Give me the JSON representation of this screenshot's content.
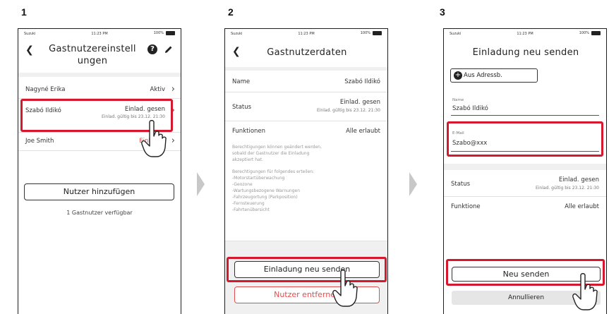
{
  "steps": [
    "1",
    "2",
    "3"
  ],
  "statusbar": {
    "carrier": "Suzuki",
    "time": "11:23 PM",
    "battery": "100%"
  },
  "panel1": {
    "title_line1": "Gastnutzereinstell",
    "title_line2": "ungen",
    "users": [
      {
        "name": "Nagyné Erika",
        "status": "Aktiv"
      },
      {
        "name": "Szabó Ildikó",
        "status": "Einlad. gesen",
        "sub": "Einlad. gültig bis 23.12. 21:30"
      },
      {
        "name": "Joe Smith",
        "status": "Einlad. a"
      }
    ],
    "add_button": "Nutzer hinzufügen",
    "available": "1 Gastnutzer verfügbar"
  },
  "panel2": {
    "title": "Gastnutzerdaten",
    "name_label": "Name",
    "name_value": "Szabó Ildikó",
    "status_label": "Status",
    "status_value": "Einlad. gesen",
    "status_sub": "Einlad. gültig bis 23.12. 21:30",
    "func_label": "Funktionen",
    "func_value": "Alle erlaubt",
    "info1": [
      "Berechtigungen können geändert werden,",
      "sobald der Gastnutzer die Einladung",
      "akzeptiert hat."
    ],
    "info2": [
      "Berechtigungen für folgendes erteilen:",
      "-Motorstartüberwachung",
      "-Geozone",
      "-Wartungsbezogene Warnungen",
      "-Fahrzeugortung (Parkposition)",
      "-Fernsteuerung",
      "-Fahrtenübersicht"
    ],
    "resend_button": "Einladung neu senden",
    "remove_button": "Nutzer entfernen"
  },
  "panel3": {
    "title": "Einladung neu senden",
    "addr_button": "Aus Adressb.",
    "name_label": "Name",
    "name_value": "Szabó Ildikó",
    "email_label": "E-Mail",
    "email_value": "Szabo@xxx",
    "status_label": "Status",
    "status_value": "Einlad. gesen",
    "status_sub": "Einlad. gültig bis 23.12. 21:30",
    "func_label": "Funktione",
    "func_value": "Alle erlaubt",
    "send_button": "Neu senden",
    "cancel_button": "Annullieren"
  },
  "colors": {
    "highlight": "#d5182e",
    "warning_text": "#e24d4d"
  }
}
